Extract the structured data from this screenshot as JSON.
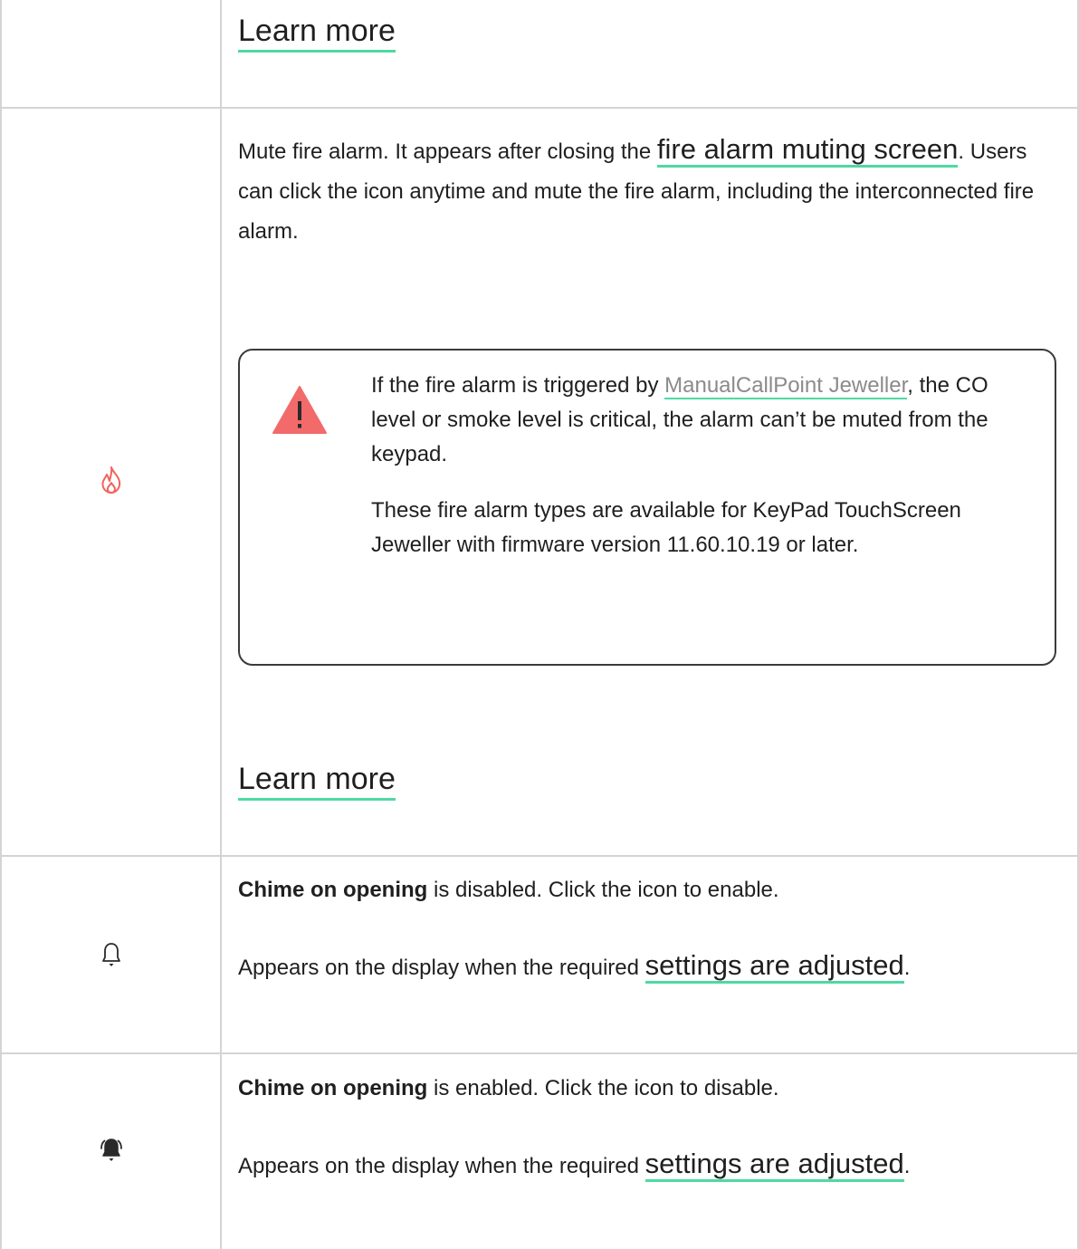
{
  "colors": {
    "accent_underline": "#4fd9a2",
    "fire_icon": "#f0645c",
    "warning_icon": "#f26a6a",
    "border": "#d4d4d4"
  },
  "rows": {
    "row0": {
      "learn_more": "Learn more"
    },
    "row1": {
      "icon": "fire-icon",
      "text_before": "Mute fire alarm. It appears after closing the ",
      "link": "fire alarm muting screen",
      "text_after": ". Users can click the icon anytime and mute the fire alarm, including the interconnected fire alarm.",
      "warning": {
        "icon": "warning-triangle-icon",
        "p1_before": "If the fire alarm is triggered by ",
        "p1_link": "ManualCallPoint Jeweller",
        "p1_after": ", the CO level or smoke level is critical, the alarm can’t be muted from the keypad.",
        "p2": "These fire alarm types are available for KeyPad TouchScreen Jeweller with firmware version 11.60.10.19 or later."
      },
      "learn_more": "Learn more"
    },
    "row2": {
      "icon": "bell-outline-icon",
      "bold": "Chime on opening",
      "text1": " is disabled. Click the icon to enable.",
      "text2_before": "Appears on the display when the required ",
      "link": "settings are adjusted",
      "text2_after": "."
    },
    "row3": {
      "icon": "bell-ringing-icon",
      "bold": "Chime on opening",
      "text1": " is enabled. Click the icon to disable.",
      "text2_before": "Appears on the display when the required ",
      "link": "settings are adjusted",
      "text2_after": "."
    }
  }
}
